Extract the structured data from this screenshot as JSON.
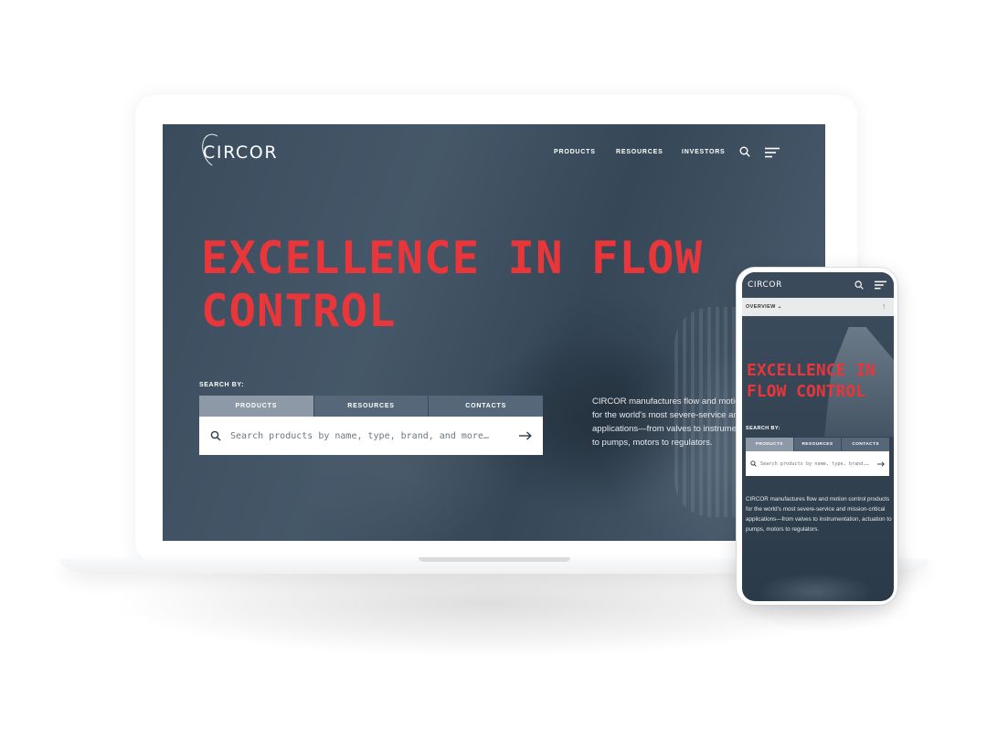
{
  "brand": {
    "logo_text": "CIRCOR",
    "accent_color": "#e8363a",
    "overlay_color": "#3a4b5c"
  },
  "desktop": {
    "nav": {
      "items": [
        "PRODUCTS",
        "RESOURCES",
        "INVESTORS"
      ]
    },
    "hero": {
      "title": "EXCELLENCE IN FLOW CONTROL",
      "search_by_label": "SEARCH BY:",
      "tabs": [
        "PRODUCTS",
        "RESOURCES",
        "CONTACTS"
      ],
      "active_tab": "PRODUCTS",
      "search_placeholder": "Search products by name, type, brand, and more…",
      "description": "CIRCOR manufactures flow and motion control products for the world's most severe-service and mission-critical applications—from valves to instrumentation, actuation to pumps, motors to regulators."
    }
  },
  "mobile": {
    "logo_text": "CIRCOR",
    "overview_label": "OVERVIEW",
    "hero": {
      "title": "EXCELLENCE IN FLOW CONTROL",
      "search_by_label": "SEARCH BY:",
      "tabs": [
        "PRODUCTS",
        "RESOURCES",
        "CONTACTS"
      ],
      "active_tab": "PRODUCTS",
      "search_placeholder": "Search products by name, type, brand,…",
      "description": "CIRCOR manufactures flow and motion control products for the world's most severe-service and mission-critical applications—from valves to instrumentation, actuation to pumps, motors to regulators."
    }
  },
  "icons": [
    "search-icon",
    "hamburger-menu-icon",
    "arrow-right-icon",
    "chevron-down-icon",
    "arrow-up-icon"
  ]
}
